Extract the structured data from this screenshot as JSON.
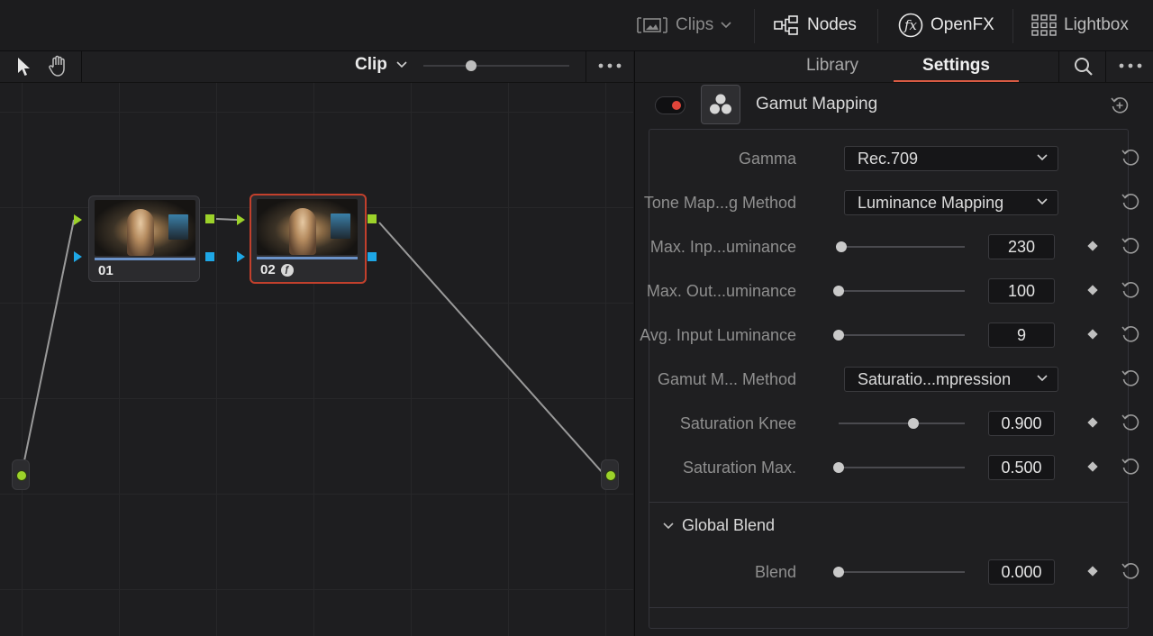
{
  "topbar": {
    "clips_label": "Clips",
    "nodes_label": "Nodes",
    "openfx_label": "OpenFX",
    "lightbox_label": "Lightbox"
  },
  "node_editor": {
    "mode_label": "Clip",
    "nodes": [
      {
        "label": "01"
      },
      {
        "label": "02"
      }
    ],
    "colors": {
      "output_port": "#9cd22a",
      "input_port": "#1ea7e6",
      "selected_border": "#c2402c"
    }
  },
  "inspector": {
    "tabs": [
      {
        "label": "Library",
        "active": false
      },
      {
        "label": "Settings",
        "active": true
      }
    ],
    "effect_name": "Gamut Mapping",
    "params": {
      "gamma": {
        "label": "Gamma",
        "value": "Rec.709"
      },
      "tone_method": {
        "label": "Tone Map...g Method",
        "value": "Luminance Mapping"
      },
      "max_input": {
        "label": "Max. Inp...uminance",
        "value": "230",
        "slider": 0.02
      },
      "max_output": {
        "label": "Max. Out...uminance",
        "value": "100",
        "slider": 0.0
      },
      "avg_input": {
        "label": "Avg. Input Luminance",
        "value": "9",
        "slider": 0.0
      },
      "gamut_method": {
        "label": "Gamut M... Method",
        "value": "Saturatio...mpression"
      },
      "sat_knee": {
        "label": "Saturation Knee",
        "value": "0.900",
        "slider": 0.59
      },
      "sat_max": {
        "label": "Saturation Max.",
        "value": "0.500",
        "slider": 0.0
      }
    },
    "global_blend": {
      "section_label": "Global Blend",
      "blend_label": "Blend",
      "blend_value": "0.000",
      "slider": 0.0
    },
    "accent_color": "#d85a43"
  }
}
